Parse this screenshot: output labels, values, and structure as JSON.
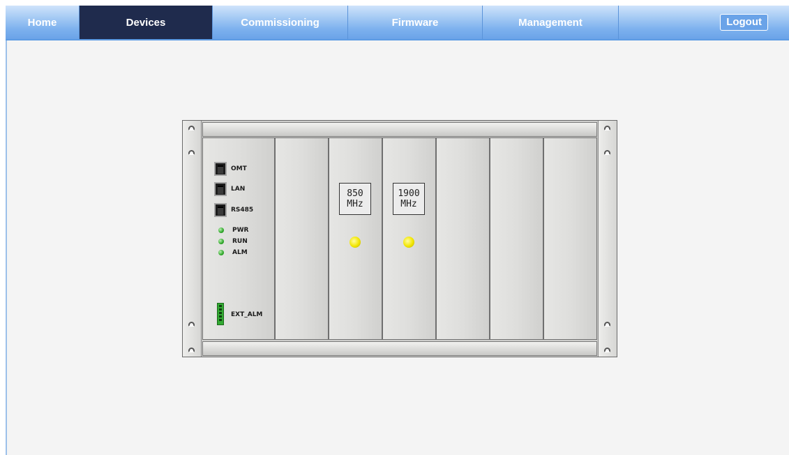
{
  "nav": {
    "tabs": [
      {
        "label": "Home"
      },
      {
        "label": "Devices"
      },
      {
        "label": "Commissioning"
      },
      {
        "label": "Firmware"
      },
      {
        "label": "Management"
      }
    ],
    "active": "Devices",
    "logout_label": "Logout"
  },
  "chassis": {
    "controller": {
      "ports": [
        "OMT",
        "LAN",
        "RS485"
      ],
      "leds": [
        "PWR",
        "RUN",
        "ALM"
      ],
      "ext_alarm": "EXT_ALM"
    },
    "bands": [
      {
        "freq": "850",
        "unit": "MHz"
      },
      {
        "freq": "1900",
        "unit": "MHz"
      }
    ]
  },
  "colors": {
    "nav_gradient_top": "#cfe3fb",
    "nav_gradient_bottom": "#6aa3e8",
    "nav_active": "#1f2b4d",
    "content_bg": "#f4f4f4",
    "led_green": "#2fa72a",
    "led_yellow": "#f2e600"
  }
}
